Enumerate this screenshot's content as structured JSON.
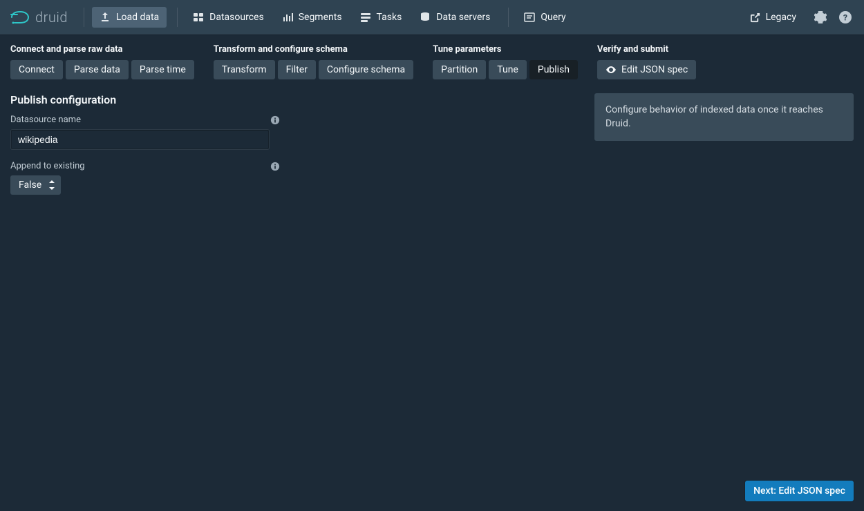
{
  "brand": {
    "name": "druid"
  },
  "nav": {
    "load_data": "Load data",
    "datasources": "Datasources",
    "segments": "Segments",
    "tasks": "Tasks",
    "data_servers": "Data servers",
    "query": "Query",
    "legacy": "Legacy"
  },
  "stepper": {
    "groups": [
      {
        "title": "Connect and parse raw data",
        "steps": [
          "Connect",
          "Parse data",
          "Parse time"
        ]
      },
      {
        "title": "Transform and configure schema",
        "steps": [
          "Transform",
          "Filter",
          "Configure schema"
        ]
      },
      {
        "title": "Tune parameters",
        "steps": [
          "Partition",
          "Tune",
          "Publish"
        ]
      },
      {
        "title": "Verify and submit",
        "steps": [
          "Edit JSON spec"
        ]
      }
    ],
    "active": "Publish"
  },
  "main": {
    "title": "Publish configuration",
    "datasource_label": "Datasource name",
    "datasource_value": "wikipedia",
    "append_label": "Append to existing",
    "append_value": "False",
    "info_text": "Configure behavior of indexed data once it reaches Druid."
  },
  "footer": {
    "next_label": "Next: Edit JSON spec"
  }
}
